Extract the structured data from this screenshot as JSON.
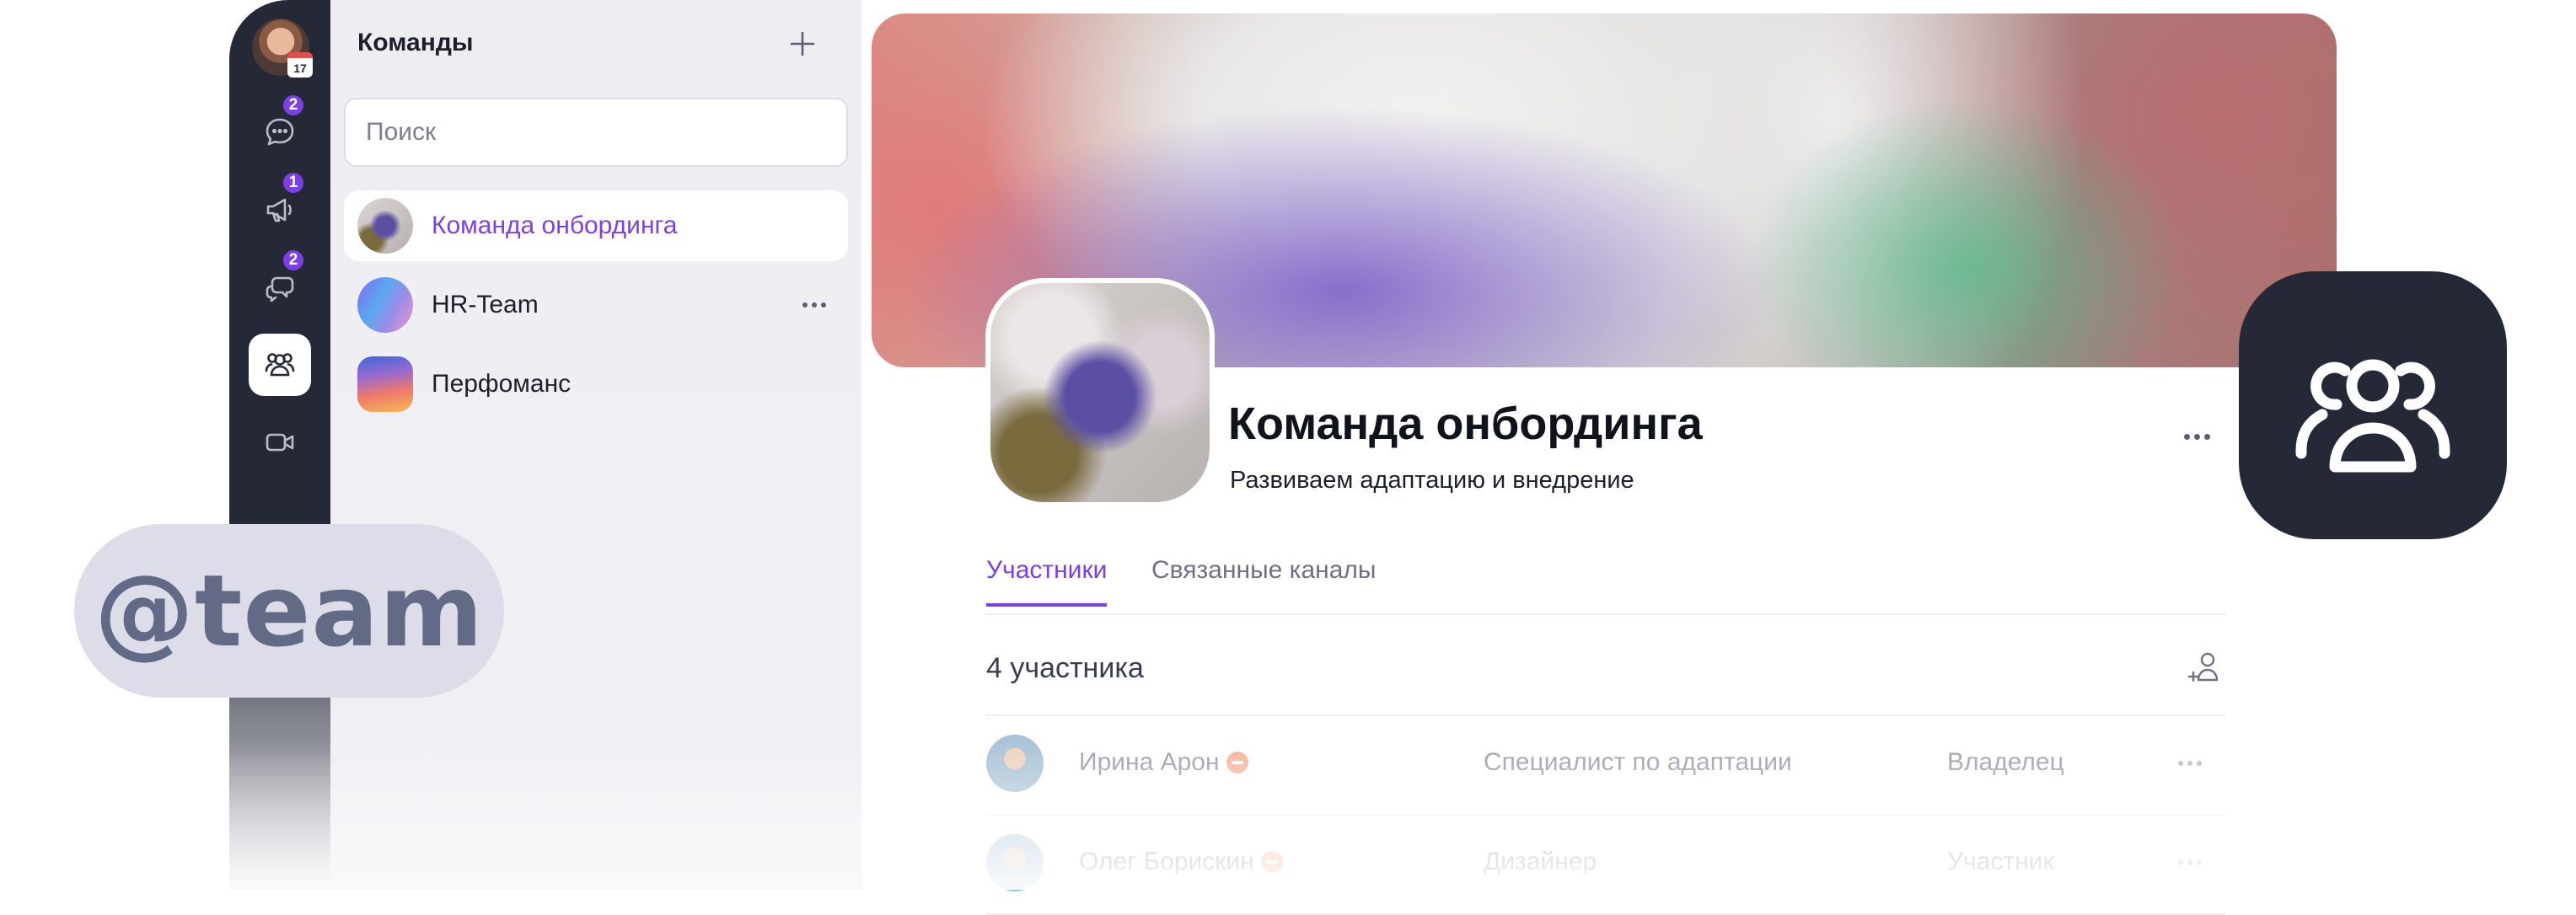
{
  "rail": {
    "calendar_day": "17",
    "badges": {
      "chats": "2",
      "channels": "1",
      "threads": "2"
    }
  },
  "teams_panel": {
    "title": "Команды",
    "search_placeholder": "Поиск",
    "items": [
      {
        "name": "Команда онбординга"
      },
      {
        "name": "HR-Team"
      },
      {
        "name": "Перфоманс"
      }
    ]
  },
  "team": {
    "title": "Команда онбординга",
    "description": "Развиваем адаптацию и внедрение",
    "tabs": [
      {
        "label": "Участники"
      },
      {
        "label": "Связанные каналы"
      }
    ],
    "members_count_label": "4 участника",
    "members": [
      {
        "name": "Ирина Арон",
        "role": "Специалист по адаптации",
        "status": "Владелец"
      },
      {
        "name": "Олег Борискин",
        "role": "Дизайнер",
        "status": "Участник"
      }
    ]
  },
  "floating_chip": {
    "text": "@team"
  },
  "colors": {
    "accent": "#7b3fe4",
    "rail_bg": "#242837",
    "panel_bg": "#ededf2",
    "dnd_status": "#f0a07e"
  },
  "icons": {
    "rail": [
      "chat-icon",
      "megaphone-icon",
      "threads-icon",
      "teams-icon",
      "video-icon"
    ],
    "app_tile": "teams-icon"
  }
}
